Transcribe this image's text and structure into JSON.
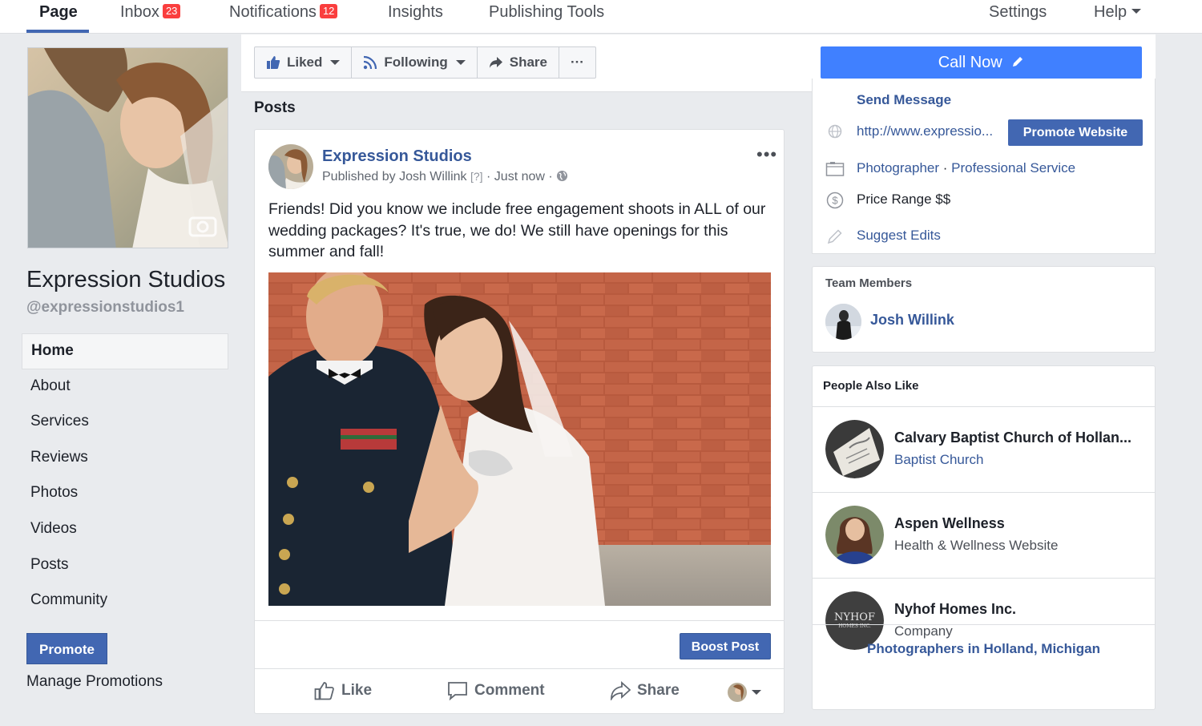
{
  "topnav": {
    "tabs": [
      {
        "label": "Page"
      },
      {
        "label": "Inbox",
        "badge": "23"
      },
      {
        "label": "Notifications",
        "badge": "12"
      },
      {
        "label": "Insights"
      },
      {
        "label": "Publishing Tools"
      }
    ],
    "settings": "Settings",
    "help": "Help"
  },
  "page": {
    "name": "Expression Studios",
    "handle": "@expressionstudios1"
  },
  "leftnav": {
    "items": [
      "Home",
      "About",
      "Services",
      "Reviews",
      "Photos",
      "Videos",
      "Posts",
      "Community"
    ],
    "promote": "Promote",
    "manage": "Manage Promotions"
  },
  "actions": {
    "liked": "Liked",
    "following": "Following",
    "share": "Share",
    "more": "···",
    "call_now": "Call Now"
  },
  "posts": {
    "title": "Posts",
    "author": "Expression Studios",
    "published_by": "Published by Josh Willink",
    "q": "[?]",
    "time": "· Just now ·",
    "text": "Friends! Did you know we include free engagement shoots in ALL of our wedding packages? It's true, we do! We still have openings for this summer and fall!",
    "boost": "Boost Post",
    "like": "Like",
    "comment": "Comment",
    "share": "Share"
  },
  "info": {
    "send_message": "Send Message",
    "website": "http://www.expressio...",
    "promote_website": "Promote Website",
    "category1": "Photographer",
    "sep": " · ",
    "category2": "Professional Service",
    "price": "Price Range $$",
    "suggest": "Suggest Edits"
  },
  "team": {
    "title": "Team Members",
    "member": "Josh Willink"
  },
  "people_also_like": {
    "title": "People Also Like",
    "items": [
      {
        "name": "Calvary Baptist Church of Hollan...",
        "sub": "Baptist Church"
      },
      {
        "name": "Aspen Wellness",
        "sub": "Health & Wellness Website"
      },
      {
        "name": "Nyhof Homes Inc.",
        "sub": "Company"
      }
    ],
    "nyhof_logo_line1": "NYHOF",
    "nyhof_logo_line2": "HOMES INC.",
    "footer": "Photographers in Holland, Michigan"
  },
  "colors": {
    "brand": "#4267b2",
    "link": "#365899",
    "call_now": "#4080ff",
    "badge": "#fa3e3e"
  }
}
